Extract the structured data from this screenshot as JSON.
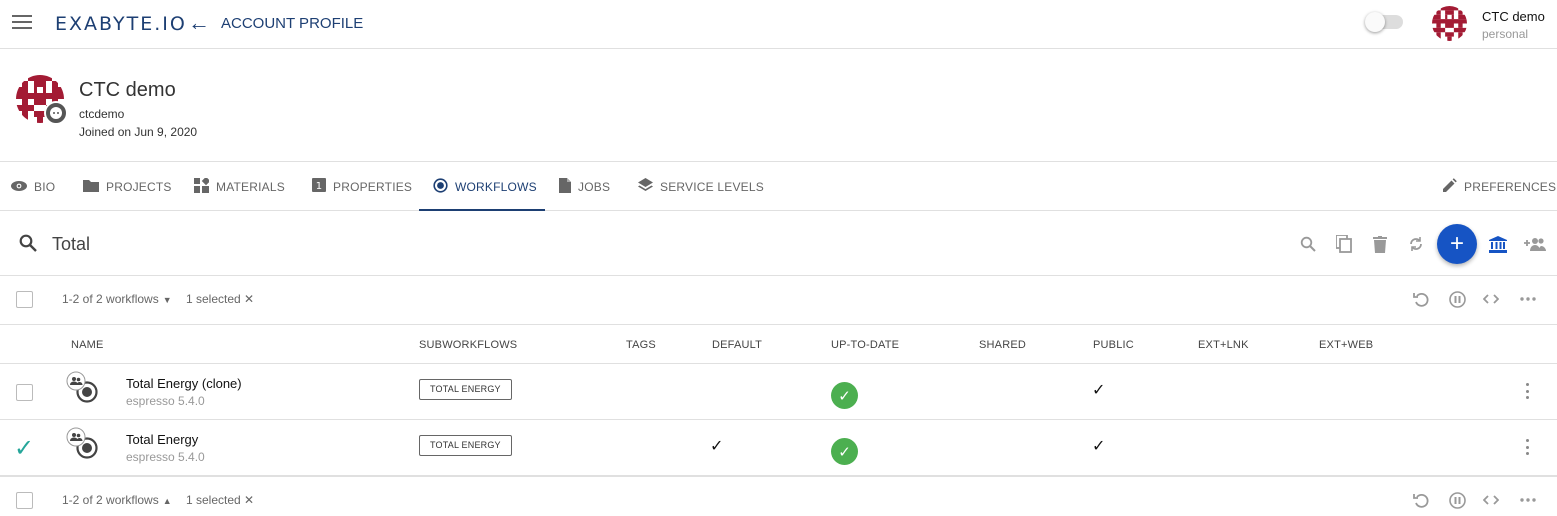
{
  "header": {
    "logo": "EXABYTE.IO",
    "title": "ACCOUNT PROFILE",
    "user_name": "CTC demo",
    "user_account": "personal"
  },
  "profile": {
    "name": "CTC demo",
    "username": "ctcdemo",
    "joined": "Joined on Jun 9, 2020"
  },
  "tabs": [
    {
      "label": "BIO",
      "icon": "eye-icon"
    },
    {
      "label": "PROJECTS",
      "icon": "folder-icon"
    },
    {
      "label": "MATERIALS",
      "icon": "materials-icon"
    },
    {
      "label": "PROPERTIES",
      "icon": "properties-icon"
    },
    {
      "label": "WORKFLOWS",
      "icon": "radio-target-icon",
      "active": true
    },
    {
      "label": "JOBS",
      "icon": "file-icon"
    },
    {
      "label": "SERVICE LEVELS",
      "icon": "layers-icon"
    },
    {
      "label": "PREFERENCES",
      "icon": "pencil-icon"
    }
  ],
  "search": {
    "value": "Total"
  },
  "pager": {
    "count_text": "1-2 of 2 workflows",
    "selected_text": "1 selected ✕"
  },
  "table": {
    "columns": [
      "NAME",
      "SUBWORKFLOWS",
      "TAGS",
      "DEFAULT",
      "UP-TO-DATE",
      "SHARED",
      "PUBLIC",
      "EXT+LNK",
      "EXT+WEB"
    ],
    "rows": [
      {
        "name": "Total Energy (clone)",
        "application": "espresso 5.4.0",
        "subworkflow": "TOTAL ENERGY",
        "default": false,
        "up_to_date": true,
        "public": true,
        "selected": false
      },
      {
        "name": "Total Energy",
        "application": "espresso 5.4.0",
        "subworkflow": "TOTAL ENERGY",
        "default": true,
        "up_to_date": true,
        "public": true,
        "selected": true
      }
    ]
  },
  "colors": {
    "brand": "#1d3f73",
    "fab": "#1654c4",
    "success": "#4caf50",
    "selected_check": "#26a69a"
  }
}
